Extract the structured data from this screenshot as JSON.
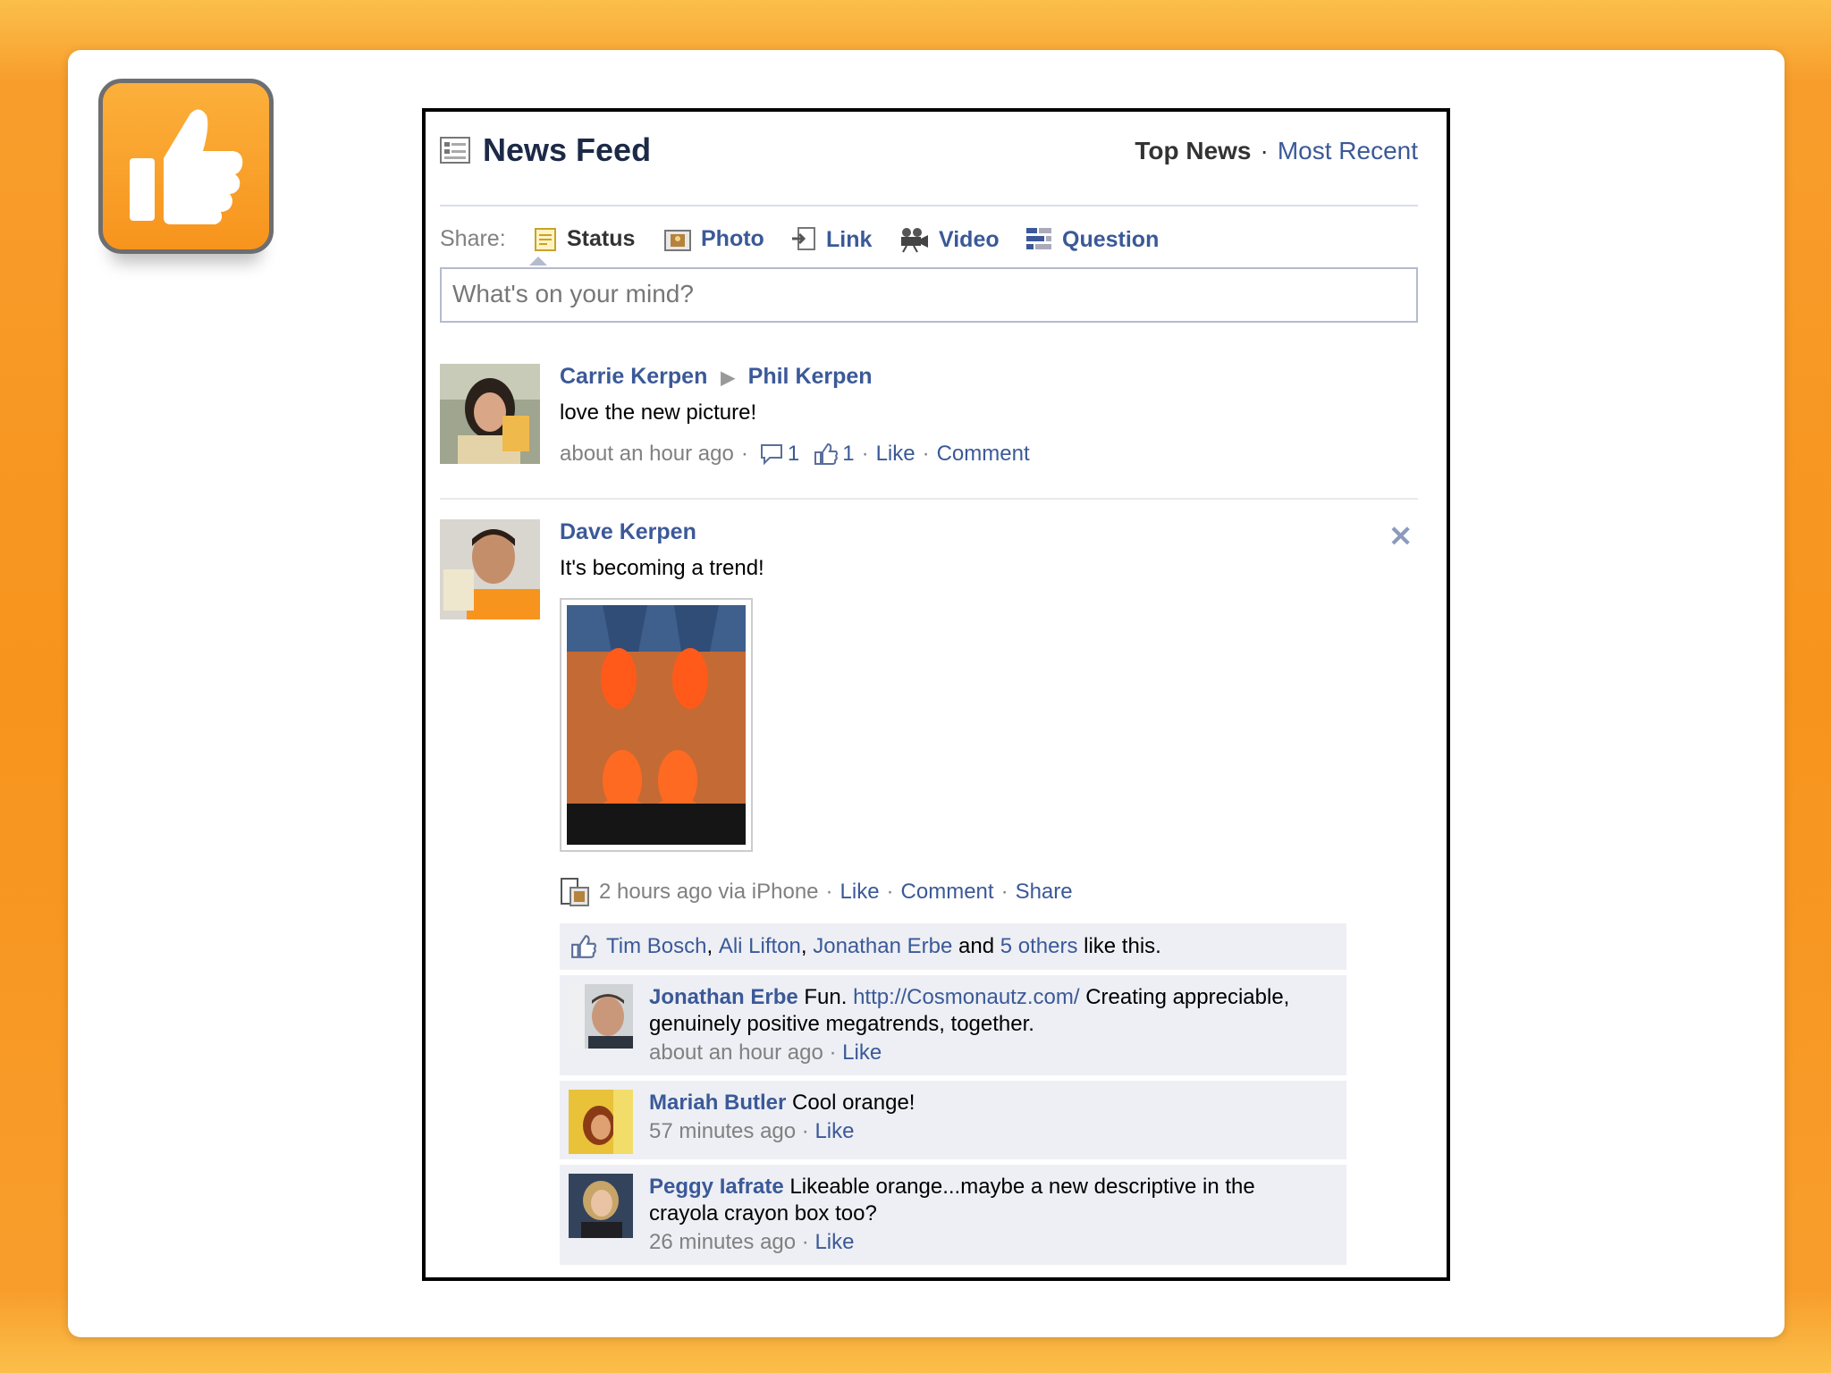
{
  "colors": {
    "fb_blue": "#3b5998",
    "accent_orange": "#f7941d",
    "meta_gray": "#808080",
    "comment_bg": "#edeff4"
  },
  "header": {
    "title": "News Feed",
    "tab_top": "Top News",
    "tab_separator": "·",
    "tab_recent": "Most Recent"
  },
  "share": {
    "label": "Share:",
    "options": [
      "Status",
      "Photo",
      "Link",
      "Video",
      "Question"
    ],
    "placeholder": "What's on your mind?"
  },
  "post1": {
    "author": "Carrie Kerpen",
    "target": "Phil Kerpen",
    "message": "love the new picture!",
    "time": "about an hour ago",
    "comments_count": "1",
    "likes_count": "1",
    "like": "Like",
    "comment": "Comment"
  },
  "post2": {
    "author": "Dave Kerpen",
    "message": "It's becoming a trend!",
    "time": "2 hours ago via iPhone",
    "like": "Like",
    "comment": "Comment",
    "share": "Share",
    "likers": [
      "Tim Bosch",
      "Ali Lifton",
      "Jonathan Erbe"
    ],
    "likes_and": "and",
    "likes_others": "5 others",
    "likes_suffix": "like this.",
    "comments": [
      {
        "author": "Jonathan Erbe",
        "text_pre": "Fun.",
        "link": "http://Cosmonautz.com/",
        "text_post": "Creating appreciable, genuinely positive megatrends, together.",
        "time": "about an hour ago",
        "like": "Like"
      },
      {
        "author": "Mariah Butler",
        "text": "Cool orange!",
        "time": "57 minutes ago",
        "like": "Like"
      },
      {
        "author": "Peggy Iafrate",
        "text": "Likeable orange...maybe a new descriptive in the crayola crayon box too?",
        "time": "26 minutes ago",
        "like": "Like"
      }
    ]
  }
}
